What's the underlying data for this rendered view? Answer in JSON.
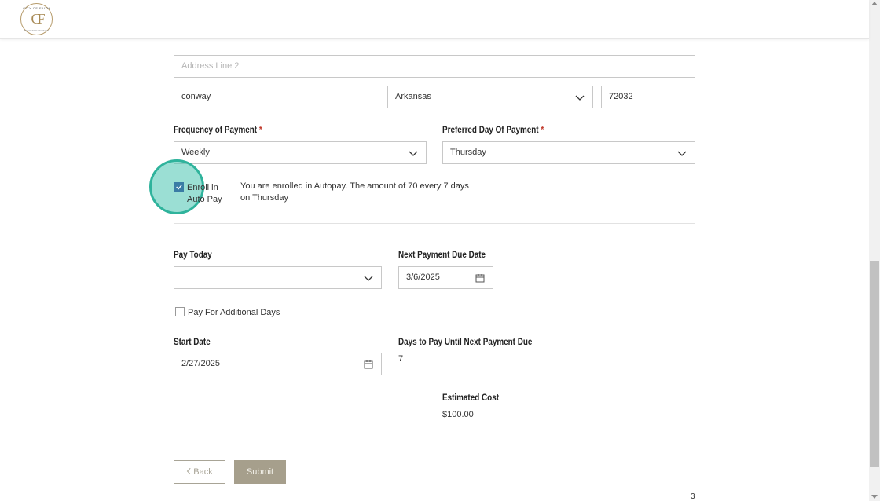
{
  "logo": {
    "ring_text": "CITY OF FAITH",
    "letters": "CF",
    "bottom_text": "RECOVERY HOUSING"
  },
  "address": {
    "line1_value": "",
    "line2_placeholder": "Address Line 2",
    "city": "conway",
    "state": "Arkansas",
    "zip": "72032"
  },
  "payment": {
    "frequency_label": "Frequency of Payment",
    "frequency_value": "Weekly",
    "preferred_day_label": "Preferred Day Of Payment",
    "preferred_day_value": "Thursday",
    "required_mark": "*"
  },
  "autopay": {
    "label_line1": "Enroll in",
    "label_line2": "Auto Pay",
    "checked": true,
    "message_line1": "You are enrolled in Autopay. The amount of 70 every 7 days",
    "message_line2": "on Thursday"
  },
  "pay_today": {
    "label": "Pay Today",
    "value": ""
  },
  "next_due": {
    "label": "Next Payment Due Date",
    "value": "3/6/2025"
  },
  "additional_days": {
    "label": "Pay For Additional Days",
    "checked": false
  },
  "start_date": {
    "label": "Start Date",
    "value": "2/27/2025"
  },
  "days_until": {
    "label": "Days to Pay Until Next Payment Due",
    "value": "7"
  },
  "estimated_cost": {
    "label": "Estimated Cost",
    "value": "$100.00"
  },
  "buttons": {
    "back": "Back",
    "submit": "Submit"
  },
  "page_number": "3",
  "colors": {
    "accent": "#a69f8c",
    "highlight": "#2fb39c",
    "checkbox": "#3a7ca5",
    "required": "#c0392b"
  }
}
